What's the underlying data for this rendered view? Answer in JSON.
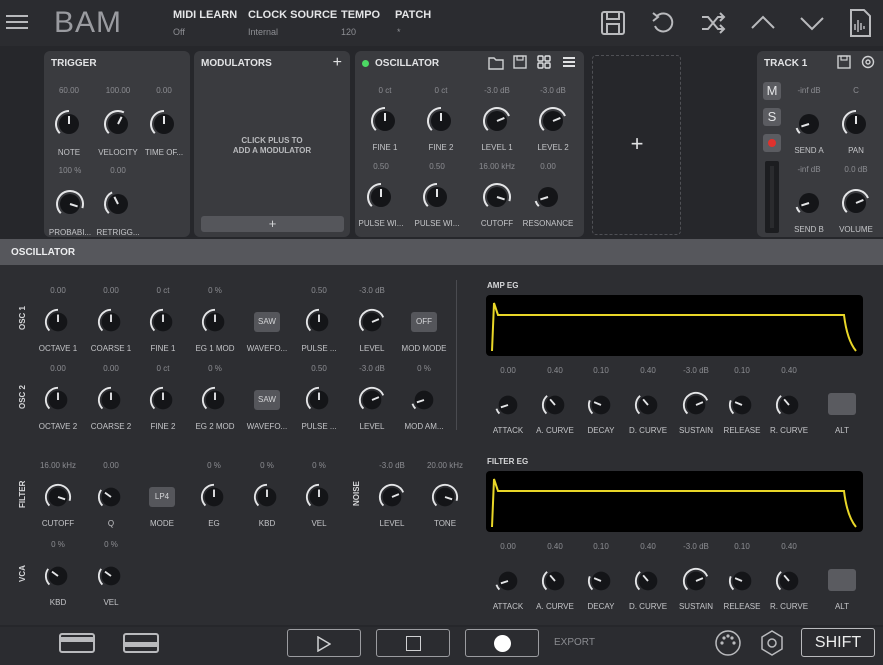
{
  "app": {
    "logo": "BAM"
  },
  "topbar": {
    "midi_learn": {
      "label": "MIDI LEARN",
      "value": "Off"
    },
    "clock_source": {
      "label": "CLOCK SOURCE",
      "value": "Internal"
    },
    "tempo": {
      "label": "TEMPO",
      "value": "120"
    },
    "patch": {
      "label": "PATCH",
      "value": "*"
    },
    "icons": [
      "menu-icon",
      "save-icon",
      "undo-icon",
      "shuffle-icon",
      "arrow-up-icon",
      "arrow-down-icon",
      "audio-file-icon"
    ]
  },
  "trigger": {
    "title": "TRIGGER",
    "knobs": [
      {
        "label": "NOTE",
        "value": "60.00"
      },
      {
        "label": "VELOCITY",
        "value": "100.00"
      },
      {
        "label": "TIME OF...",
        "value": "0.00"
      },
      {
        "label": "PROBABI...",
        "value": "100 %"
      },
      {
        "label": "RETRIGG...",
        "value": "0.00"
      }
    ]
  },
  "modulators": {
    "title": "MODULATORS",
    "hint_line1": "CLICK PLUS TO",
    "hint_line2": "ADD A MODULATOR",
    "add": "+"
  },
  "oscillator_card": {
    "title": "OSCILLATOR",
    "knobs": [
      {
        "label": "FINE 1",
        "value": "0 ct"
      },
      {
        "label": "FINE 2",
        "value": "0 ct"
      },
      {
        "label": "LEVEL 1",
        "value": "-3.0 dB"
      },
      {
        "label": "LEVEL 2",
        "value": "-3.0 dB"
      },
      {
        "label": "PULSE WI...",
        "value": "0.50"
      },
      {
        "label": "PULSE WI...",
        "value": "0.50"
      },
      {
        "label": "CUTOFF",
        "value": "16.00 kHz"
      },
      {
        "label": "RESONANCE",
        "value": "0.00"
      }
    ]
  },
  "empty_slot": {
    "add": "+"
  },
  "track": {
    "title": "TRACK 1",
    "buttons": [
      "M",
      "S"
    ],
    "knobs": [
      {
        "label": "SEND A",
        "value": "-inf dB"
      },
      {
        "label": "PAN",
        "value": "C"
      },
      {
        "label": "SEND B",
        "value": "-inf dB"
      },
      {
        "label": "VOLUME",
        "value": "0.0 dB"
      }
    ]
  },
  "editor": {
    "title": "OSCILLATOR",
    "osc1": {
      "section": "OSC 1",
      "knobs": [
        {
          "label": "OCTAVE 1",
          "value": "0.00"
        },
        {
          "label": "COARSE 1",
          "value": "0.00"
        },
        {
          "label": "FINE 1",
          "value": "0 ct"
        },
        {
          "label": "EG 1 MOD",
          "value": "0 %"
        },
        {
          "label": "WAVEFO...",
          "value": "",
          "button": "SAW"
        },
        {
          "label": "PULSE ...",
          "value": "0.50"
        },
        {
          "label": "LEVEL",
          "value": "-3.0 dB"
        },
        {
          "label": "MOD MODE",
          "value": "",
          "button": "OFF"
        }
      ]
    },
    "osc2": {
      "section": "OSC 2",
      "knobs": [
        {
          "label": "OCTAVE 2",
          "value": "0.00"
        },
        {
          "label": "COARSE 2",
          "value": "0.00"
        },
        {
          "label": "FINE 2",
          "value": "0 ct"
        },
        {
          "label": "EG 2 MOD",
          "value": "0 %"
        },
        {
          "label": "WAVEFO...",
          "value": "",
          "button": "SAW"
        },
        {
          "label": "PULSE ...",
          "value": "0.50"
        },
        {
          "label": "LEVEL",
          "value": "-3.0 dB"
        },
        {
          "label": "MOD AM...",
          "value": "0 %"
        }
      ]
    },
    "filter": {
      "section": "FILTER",
      "knobs": [
        {
          "label": "CUTOFF",
          "value": "16.00 kHz"
        },
        {
          "label": "Q",
          "value": "0.00"
        },
        {
          "label": "MODE",
          "value": "",
          "button": "LP4"
        },
        {
          "label": "EG",
          "value": "0 %"
        },
        {
          "label": "KBD",
          "value": "0 %"
        },
        {
          "label": "VEL",
          "value": "0 %"
        }
      ]
    },
    "noise": {
      "section": "NOISE",
      "knobs": [
        {
          "label": "LEVEL",
          "value": "-3.0 dB"
        },
        {
          "label": "TONE",
          "value": "20.00 kHz"
        }
      ]
    },
    "vca": {
      "section": "VCA",
      "knobs": [
        {
          "label": "KBD",
          "value": "0 %"
        },
        {
          "label": "VEL",
          "value": "0 %"
        }
      ]
    },
    "amp_eg": {
      "title": "AMP EG",
      "knobs": [
        {
          "label": "ATTACK",
          "value": "0.00"
        },
        {
          "label": "A. CURVE",
          "value": "0.40"
        },
        {
          "label": "DECAY",
          "value": "0.10"
        },
        {
          "label": "D. CURVE",
          "value": "0.40"
        },
        {
          "label": "SUSTAIN",
          "value": "-3.0 dB"
        },
        {
          "label": "RELEASE",
          "value": "0.10"
        },
        {
          "label": "R. CURVE",
          "value": "0.40"
        },
        {
          "label": "ALT",
          "value": ""
        }
      ]
    },
    "filter_eg": {
      "title": "FILTER EG",
      "knobs": [
        {
          "label": "ATTACK",
          "value": "0.00"
        },
        {
          "label": "A. CURVE",
          "value": "0.40"
        },
        {
          "label": "DECAY",
          "value": "0.10"
        },
        {
          "label": "D. CURVE",
          "value": "0.40"
        },
        {
          "label": "SUSTAIN",
          "value": "-3.0 dB"
        },
        {
          "label": "RELEASE",
          "value": "0.10"
        },
        {
          "label": "R. CURVE",
          "value": "0.40"
        },
        {
          "label": "ALT",
          "value": ""
        }
      ]
    }
  },
  "bottom": {
    "export": "EXPORT",
    "shift": "SHIFT"
  },
  "colors": {
    "accent": "#e8d628",
    "record": "#e0312d",
    "active": "#4cd964"
  }
}
